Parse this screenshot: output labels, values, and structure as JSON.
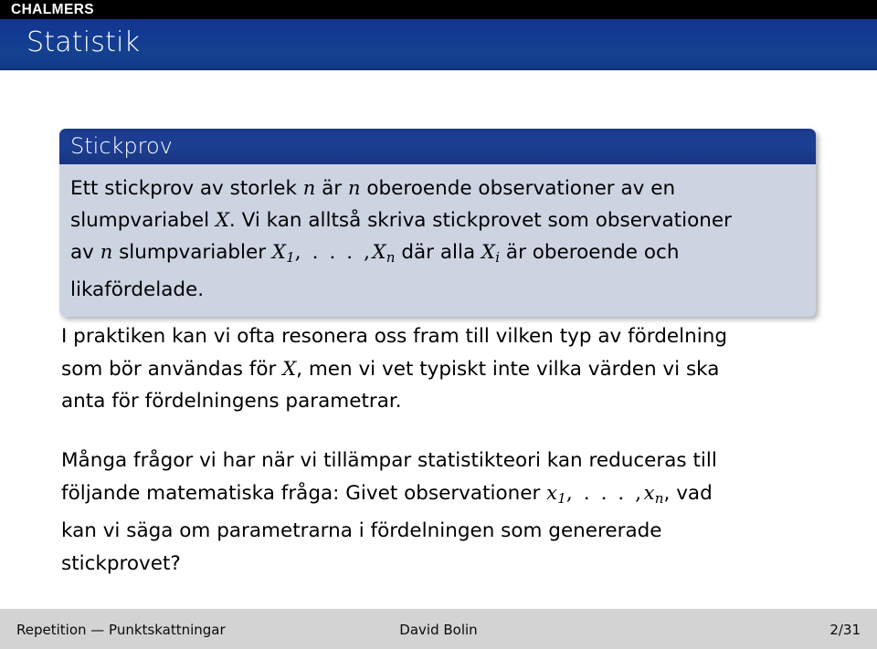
{
  "logobar": {
    "brand": "CHALMERS"
  },
  "titlebar": {
    "frame_title": "Statistik",
    "background_color": "#123a92",
    "text_color": "#ffffff"
  },
  "block": {
    "title": "Stickprov",
    "title_bg_color": "#1d3f93",
    "body_bg_color": "#ccd4e2",
    "lines": [
      {
        "segments": [
          {
            "type": "text",
            "value": "Ett stickprov av storlek "
          },
          {
            "type": "math",
            "value": "n"
          },
          {
            "type": "text",
            "value": " är "
          },
          {
            "type": "math",
            "value": "n"
          },
          {
            "type": "text",
            "value": " oberoende observationer av en"
          }
        ]
      },
      {
        "segments": [
          {
            "type": "text",
            "value": "slumpvariabel "
          },
          {
            "type": "math",
            "value": "X"
          },
          {
            "type": "text",
            "value": ". Vi kan alltså skriva stickprovet som observationer"
          }
        ]
      },
      {
        "segments": [
          {
            "type": "text",
            "value": "av "
          },
          {
            "type": "math",
            "value": "n"
          },
          {
            "type": "text",
            "value": " slumpvariabler "
          },
          {
            "type": "math",
            "value": "X",
            "sub": "1"
          },
          {
            "type": "mathplain",
            "value": ", . . . ,"
          },
          {
            "type": "math",
            "value": "X",
            "sub": "n"
          },
          {
            "type": "text",
            "value": " där alla "
          },
          {
            "type": "math",
            "value": "X",
            "sub": "i"
          },
          {
            "type": "text",
            "value": " är oberoende och"
          }
        ]
      },
      {
        "segments": [
          {
            "type": "text",
            "value": "likafördelade."
          }
        ]
      }
    ]
  },
  "paragraphs": [
    {
      "id": "paragraph-distribution-type",
      "lines": [
        {
          "segments": [
            {
              "type": "text",
              "value": "I praktiken kan vi ofta resonera oss fram till vilken typ av fördelning"
            }
          ]
        },
        {
          "segments": [
            {
              "type": "text",
              "value": "som bör användas för "
            },
            {
              "type": "math",
              "value": "X"
            },
            {
              "type": "text",
              "value": ", men vi vet typiskt inte vilka värden vi ska"
            }
          ]
        },
        {
          "segments": [
            {
              "type": "text",
              "value": "anta för fördelningens parametrar."
            }
          ]
        }
      ]
    },
    {
      "id": "paragraph-statistical-question",
      "lines": [
        {
          "segments": [
            {
              "type": "text",
              "value": "Många frågor vi har när vi tillämpar statistikteori kan reduceras till"
            }
          ]
        },
        {
          "segments": [
            {
              "type": "text",
              "value": "följande matematiska fråga:  Givet observationer "
            },
            {
              "type": "math",
              "value": "x",
              "sub": "1"
            },
            {
              "type": "mathplain",
              "value": ", . . . ,"
            },
            {
              "type": "math",
              "value": "x",
              "sub": "n"
            },
            {
              "type": "text",
              "value": ", vad"
            }
          ]
        },
        {
          "segments": [
            {
              "type": "text",
              "value": "kan vi säga om parametrarna i fördelningen som genererade"
            }
          ]
        },
        {
          "segments": [
            {
              "type": "text",
              "value": "stickprovet?"
            }
          ]
        }
      ]
    }
  ],
  "footer": {
    "left": "Repetition — Punktskattningar",
    "center": "David Bolin",
    "right": "2/31",
    "background_color": "#d3d3d3"
  }
}
